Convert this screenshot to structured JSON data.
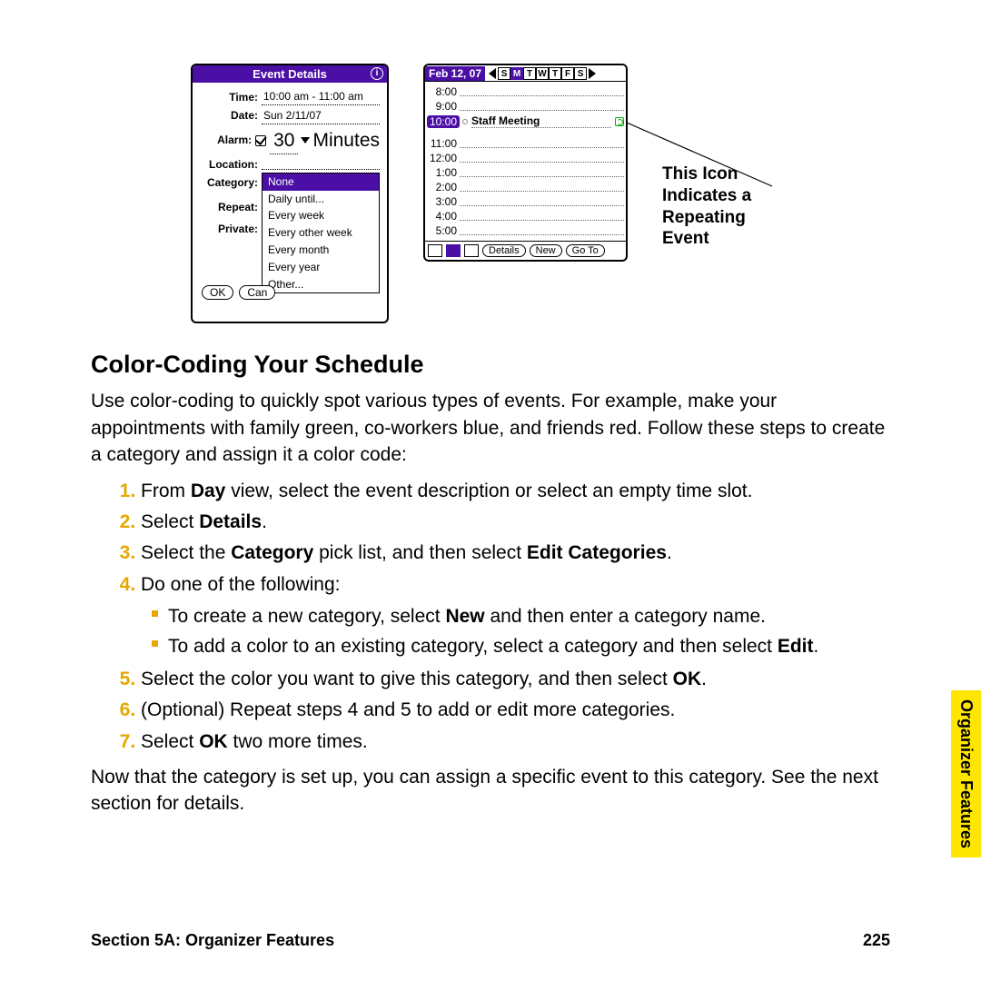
{
  "dialog": {
    "title": "Event Details",
    "rows": {
      "time_label": "Time:",
      "time_value": "10:00 am - 11:00 am",
      "date_label": "Date:",
      "date_value": "Sun 2/11/07",
      "alarm_label": "Alarm:",
      "alarm_value": "30",
      "alarm_unit": "Minutes",
      "location_label": "Location:",
      "location_value": "",
      "category_label": "Category:",
      "repeat_label": "Repeat:",
      "private_label": "Private:"
    },
    "dropdown": [
      "None",
      "Daily until...",
      "Every week",
      "Every other week",
      "Every month",
      "Every year",
      "Other..."
    ],
    "dropdown_selected": 0,
    "buttons": {
      "ok": "OK",
      "cancel": "Can"
    }
  },
  "calendar": {
    "date": "Feb 12, 07",
    "days": [
      "S",
      "M",
      "T",
      "W",
      "T",
      "F",
      "S"
    ],
    "day_selected": 1,
    "times": [
      "8:00",
      "9:00",
      "10:00",
      "11:00",
      "12:00",
      "1:00",
      "2:00",
      "3:00",
      "4:00",
      "5:00"
    ],
    "event_time": "10:00",
    "event_title": "Staff Meeting",
    "footer": {
      "details": "Details",
      "new": "New",
      "goto": "Go To"
    }
  },
  "callout_text": "This Icon Indicates a Repeating Event",
  "heading": "Color-Coding Your Schedule",
  "intro": "Use color-coding to quickly spot various types of events. For example, make your appointments with family green, co-workers blue, and friends red. Follow these steps to create a category and assign it a color code:",
  "steps": {
    "s1a": "From ",
    "s1b": "Day",
    "s1c": " view, select the event description or select an empty time slot.",
    "s2a": "Select ",
    "s2b": "Details",
    "s2c": ".",
    "s3a": "Select the ",
    "s3b": "Category",
    "s3c": " pick list, and then select ",
    "s3d": "Edit Categories",
    "s3e": ".",
    "s4": "Do one of the following:",
    "s4_1a": "To create a new category, select ",
    "s4_1b": "New",
    "s4_1c": " and then enter a category name.",
    "s4_2a": "To add a color to an existing category, select a category and then select ",
    "s4_2b": "Edit",
    "s4_2c": ".",
    "s5a": "Select the color you want to give this category, and then select ",
    "s5b": "OK",
    "s5c": ".",
    "s6": "(Optional) Repeat steps 4 and 5 to add or edit more categories.",
    "s7a": "Select ",
    "s7b": "OK",
    "s7c": " two more times."
  },
  "outro": "Now that the category is set up, you can assign a specific event to this category. See the next section for details.",
  "sidetab": "Organizer Features",
  "footer": {
    "section": "Section 5A: Organizer Features",
    "page": "225"
  }
}
